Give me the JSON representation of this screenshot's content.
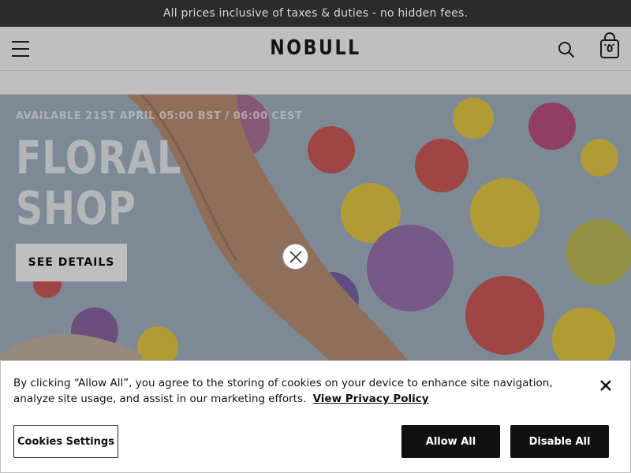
{
  "announcement": {
    "text": "All prices inclusive of taxes & duties - no hidden fees."
  },
  "header": {
    "brand": "NOBULL",
    "cart_count": "0",
    "icons": {
      "menu": "hamburger-menu-icon",
      "search": "search-icon",
      "cart": "shopping-bag-icon"
    }
  },
  "hero": {
    "kicker": "AVAILABLE 21ST APRIL 05:00 BST / 06:00 CEST",
    "title_line1": "FLORAL",
    "title_line2": "SHOP",
    "cta": "SEE DETAILS"
  },
  "modal": {
    "close_icon": "close-circle-icon"
  },
  "cookie_banner": {
    "text": "By clicking “Allow All”, you agree to the storing of cookies on your device to enhance site navigation, analyze site usage, and assist in our marketing efforts.",
    "privacy_link": "View Privacy Policy",
    "settings_label": "Cookies Settings",
    "allow_label": "Allow All",
    "disable_label": "Disable All",
    "close_icon": "close-icon"
  },
  "colors": {
    "announce_bg": "#2b2b2b",
    "button_dark": "#111111",
    "overlay": "rgba(0,0,0,0.25)"
  }
}
